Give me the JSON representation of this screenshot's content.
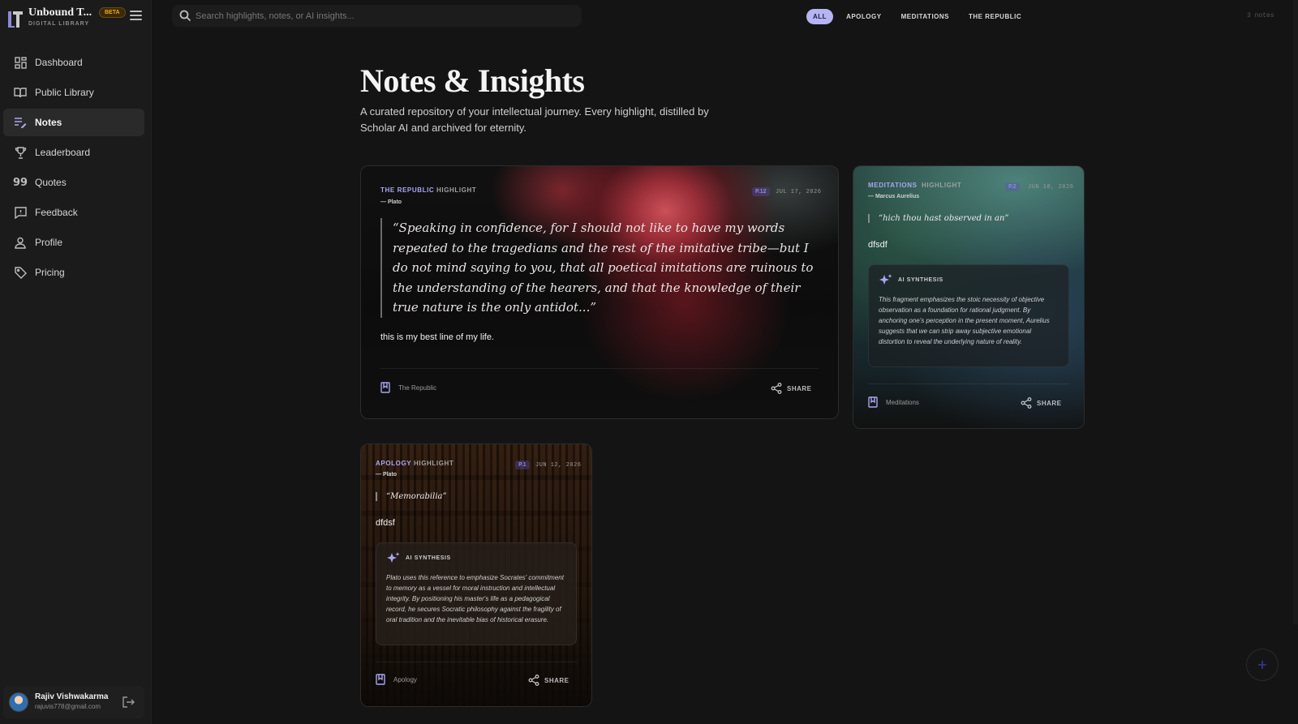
{
  "brand": {
    "title": "Unbound T...",
    "subtitle": "DIGITAL LIBRARY",
    "badge": "BETA"
  },
  "sidebar": {
    "items": [
      {
        "label": "Dashboard",
        "icon": "dashboard-icon"
      },
      {
        "label": "Public Library",
        "icon": "book-open-icon"
      },
      {
        "label": "Notes",
        "icon": "notes-icon",
        "active": true
      },
      {
        "label": "Leaderboard",
        "icon": "trophy-icon"
      },
      {
        "label": "Quotes",
        "icon": "quote-icon"
      },
      {
        "label": "Feedback",
        "icon": "feedback-icon"
      },
      {
        "label": "Profile",
        "icon": "user-icon"
      },
      {
        "label": "Pricing",
        "icon": "tag-icon"
      }
    ]
  },
  "user": {
    "name": "Rajiv Vishwakarma",
    "email": "rajuvis778@gmail.com"
  },
  "search": {
    "placeholder": "Search highlights, notes, or AI insights..."
  },
  "filters": [
    {
      "label": "ALL",
      "active": true
    },
    {
      "label": "APOLOGY"
    },
    {
      "label": "MEDITATIONS"
    },
    {
      "label": "THE REPUBLIC"
    }
  ],
  "note_count": "3 notes",
  "header": {
    "title": "Notes & Insights",
    "description": "A curated repository of your intellectual journey. Every highlight, distilled by Scholar AI and archived for eternity."
  },
  "cards": {
    "republic": {
      "book": "THE REPUBLIC",
      "type": "HIGHLIGHT",
      "author": "— Plato",
      "page": "P.12",
      "date": "JUL 17, 2026",
      "quote": "“Speaking in confidence, for I should not like to have my words repeated to the tragedians and the rest of the imitative tribe—but I do not mind saying to you, that all poetical imitations are ruinous to the understanding of the hearers, and that the knowledge of their true nature is the only antidot...”",
      "note": "this is my best line of my life.",
      "footer_book": "The Republic",
      "share": "SHARE"
    },
    "meditations": {
      "book": "MEDITATIONS",
      "type": "HIGHLIGHT",
      "author": "— Marcus Aurelius",
      "page": "P.2",
      "date": "JUN 18, 2026",
      "quote": "“hich thou hast observed in an”",
      "note": "dfsdf",
      "ai_title": "AI SYNTHESIS",
      "ai_text": "This fragment emphasizes the stoic necessity of objective observation as a foundation for rational judgment. By anchoring one's perception in the present moment, Aurelius suggests that we can strip away subjective emotional distortion to reveal the underlying nature of reality.",
      "footer_book": "Meditations",
      "share": "SHARE"
    },
    "apology": {
      "book": "APOLOGY",
      "type": "HIGHLIGHT",
      "author": "— Plato",
      "page": "P.1",
      "date": "JUN 12, 2026",
      "quote": "“Memorabilia”",
      "note": "dfdsf",
      "ai_title": "AI SYNTHESIS",
      "ai_text": "Plato uses this reference to emphasize Socrates' commitment to memory as a vessel for moral instruction and intellectual integrity. By positioning his master's life as a pedagogical record, he secures Socratic philosophy against the fragility of oral tradition and the inevitable bias of historical erasure.",
      "footer_book": "Apology",
      "share": "SHARE"
    }
  },
  "colors": {
    "accent": "#b7b4f4",
    "beta": "#f0a820",
    "background": "#141414",
    "sidebar": "#1b1b1b"
  }
}
